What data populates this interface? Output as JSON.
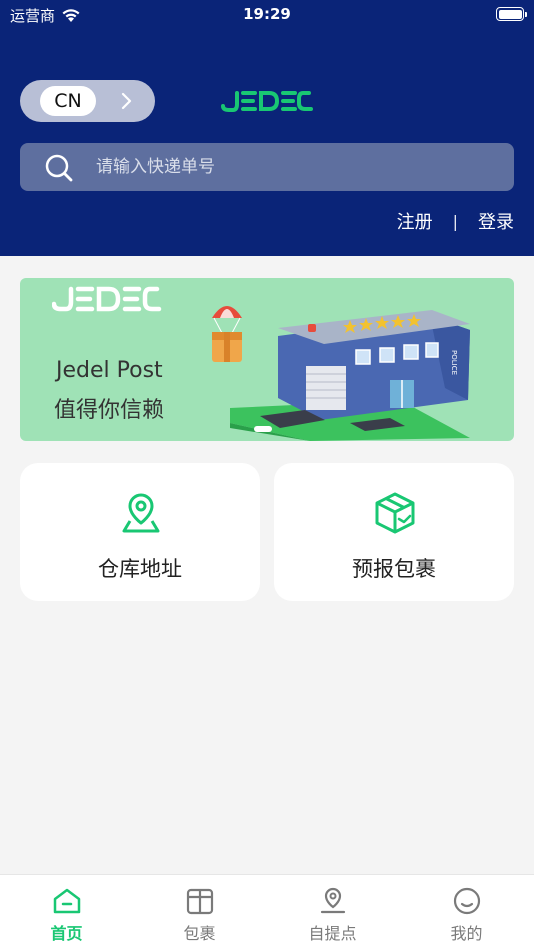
{
  "status_bar": {
    "carrier": "运营商",
    "time": "19:29"
  },
  "header": {
    "language_code": "CN",
    "logo_text": "JEDEL",
    "search_placeholder": "请输入快递单号",
    "register_label": "注册",
    "separator": "|",
    "login_label": "登录"
  },
  "banner": {
    "logo_text": "JEDEL",
    "title": "Jedel Post",
    "subtitle": "值得你信赖",
    "building_sign": "POLICE"
  },
  "cards": [
    {
      "label": "仓库地址",
      "icon": "location-pin-icon"
    },
    {
      "label": "预报包裹",
      "icon": "package-box-icon"
    }
  ],
  "tabbar": {
    "items": [
      {
        "label": "首页",
        "icon": "home-icon",
        "active": true
      },
      {
        "label": "包裹",
        "icon": "package-icon",
        "active": false
      },
      {
        "label": "自提点",
        "icon": "pickup-point-icon",
        "active": false
      },
      {
        "label": "我的",
        "icon": "profile-smile-icon",
        "active": false
      }
    ]
  },
  "colors": {
    "header_bg": "#0a2478",
    "accent_green": "#19c773",
    "banner_bg": "#9fe2b6",
    "page_bg": "#f4f4f4"
  }
}
